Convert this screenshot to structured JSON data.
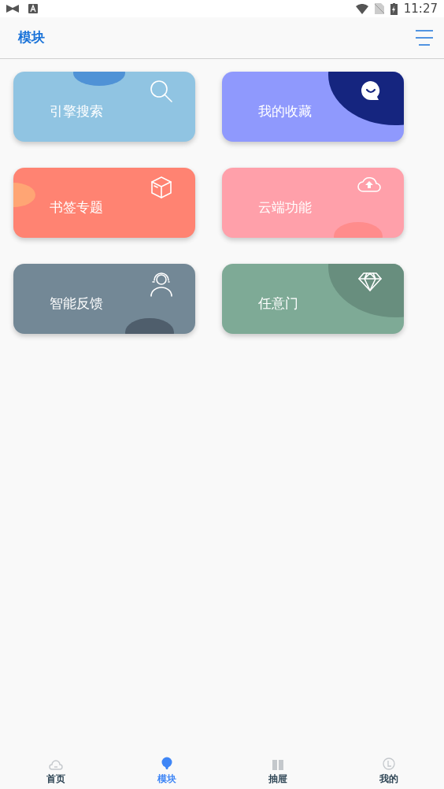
{
  "status_bar": {
    "time": "11:27"
  },
  "header": {
    "title": "模块"
  },
  "cards": [
    {
      "label": "引擎搜索",
      "kind": "search",
      "color": "#90c4e2"
    },
    {
      "label": "我的收藏",
      "kind": "favorite",
      "color": "#8f99fd"
    },
    {
      "label": "书签专题",
      "kind": "bookmark",
      "color": "#ff8372"
    },
    {
      "label": "云端功能",
      "kind": "cloud",
      "color": "#ffa0aa"
    },
    {
      "label": "智能反馈",
      "kind": "feedback",
      "color": "#738896"
    },
    {
      "label": "任意门",
      "kind": "door",
      "color": "#7eaa96"
    }
  ],
  "tabs": [
    {
      "label": "首页",
      "kind": "home",
      "selected": false
    },
    {
      "label": "模块",
      "kind": "module",
      "selected": true
    },
    {
      "label": "抽屉",
      "kind": "drawer",
      "selected": false
    },
    {
      "label": "我的",
      "kind": "mine",
      "selected": false
    }
  ]
}
